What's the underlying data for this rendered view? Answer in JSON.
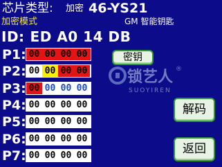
{
  "header": {
    "chip_type_label": "芯片类型:",
    "chip_mode_small": "加密",
    "chip_model": "46-YS21",
    "mode_text": "加密模式",
    "key_type": "GM 智能钥匙"
  },
  "id_line": {
    "label": "ID:",
    "bytes": [
      "ED",
      "A0",
      "14",
      "DB"
    ]
  },
  "pages": [
    {
      "label": "P1:",
      "cells": [
        "00",
        "00",
        "00",
        "00"
      ]
    },
    {
      "label": "P2:",
      "cells": [
        "00",
        "00",
        "00",
        "00"
      ]
    },
    {
      "label": "P3:",
      "cells": [
        "00",
        "00",
        "00",
        "00"
      ]
    },
    {
      "label": "P4:",
      "cells": [
        "00",
        "00",
        "00",
        "00"
      ]
    },
    {
      "label": "P5:",
      "cells": [
        "00",
        "00",
        "00",
        "00"
      ]
    },
    {
      "label": "P6:",
      "cells": [
        "00",
        "00",
        "00",
        "00"
      ]
    },
    {
      "label": "P7:",
      "cells": [
        "00",
        "00",
        "00",
        "00"
      ]
    }
  ],
  "buttons": {
    "key": "密钥",
    "decode": "解码",
    "back": "返回"
  },
  "watermark": {
    "brand": "锁艺人",
    "brand_latin": "SUOYIREN",
    "reg_mark": "®"
  },
  "colors": {
    "background": "#0c0c8a",
    "mode_text": "#f6ea2a",
    "cell_red": "#e51414",
    "cell_yellow": "#f7ef00",
    "cell_blue_text": "#1b49c8",
    "button_border": "#2f9a32"
  }
}
